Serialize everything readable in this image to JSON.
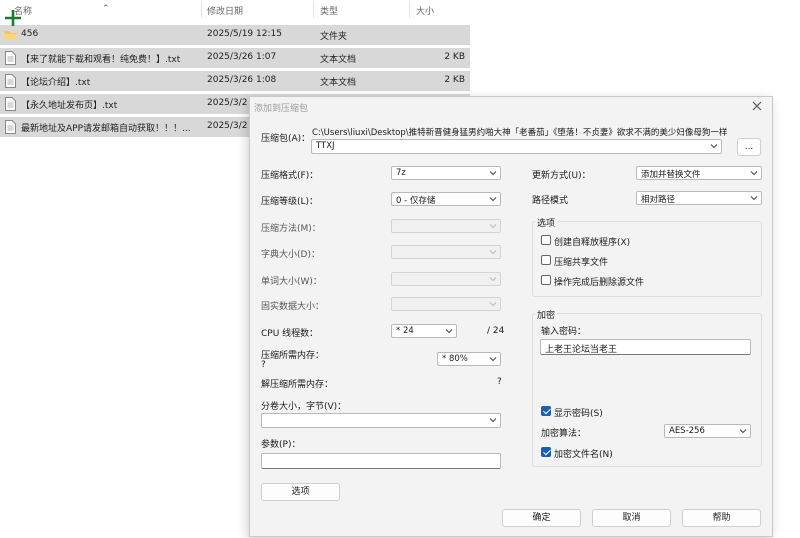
{
  "explorer": {
    "columns": {
      "name": "名称",
      "modified": "修改日期",
      "type": "类型",
      "size": "大小"
    },
    "files": [
      {
        "name": "456",
        "modified": "2025/5/19 12:15",
        "type": "文件夹",
        "size": "",
        "icon": "folder-icon"
      },
      {
        "name": "【来了就能下载和观看！纯免费！】.txt",
        "modified": "2025/3/26 1:07",
        "type": "文本文档",
        "size": "2 KB",
        "icon": "text-file-icon"
      },
      {
        "name": "【论坛介绍】.txt",
        "modified": "2025/3/26 1:08",
        "type": "文本文档",
        "size": "2 KB",
        "icon": "text-file-icon"
      },
      {
        "name": "【永久地址发布页】.txt",
        "modified": "2025/3/2",
        "type": "",
        "size": "",
        "icon": "text-file-icon"
      },
      {
        "name": "最新地址及APP请发邮箱自动获取！！！...",
        "modified": "2025/3/2",
        "type": "",
        "size": "",
        "icon": "text-file-icon"
      }
    ]
  },
  "dialog": {
    "title": "添加到压缩包",
    "archive_label": "压缩包(A)：",
    "archive_path": "C:\\Users\\liuxi\\Desktop\\推特新晋健身猛男约啪大神「老番茄」《堕落！不贞妻》欲求不满的美少妇像母狗一样",
    "archive_name": "TTXJ",
    "browse_label": "...",
    "left": {
      "format_label": "压缩格式(F)：",
      "format_value": "7z",
      "level_label": "压缩等级(L)：",
      "level_value": "0 - 仅存储",
      "method_label": "压缩方法(M)：",
      "dict_label": "字典大小(D)：",
      "word_label": "单词大小(W)：",
      "solid_label": "固实数据大小：",
      "cpu_label": "CPU 线程数：",
      "cpu_value": "* 24",
      "cpu_total": "/ 24",
      "mem_comp_label": "压缩所需内存：",
      "mem_comp_q": "?",
      "mem_comp_value": "* 80%",
      "mem_decomp_label": "解压缩所需内存：",
      "mem_decomp_q": "?",
      "split_label": "分卷大小，字节(V)：",
      "params_label": "参数(P)：",
      "options_button": "选项"
    },
    "right": {
      "update_label": "更新方式(U)：",
      "update_value": "添加并替换文件",
      "pathmode_label": "路径模式",
      "pathmode_value": "相对路径",
      "options_group": "选项",
      "opt_sfx": "创建自释放程序(X)",
      "opt_shared": "压缩共享文件",
      "opt_delete": "操作完成后删除源文件",
      "encrypt_group": "加密",
      "password_label": "输入密码：",
      "password_value": "上老王论坛当老王",
      "show_password": "显示密码(S)",
      "encrypt_method_label": "加密算法：",
      "encrypt_method_value": "AES-256",
      "encrypt_names": "加密文件名(N)"
    },
    "buttons": {
      "ok": "确定",
      "cancel": "取消",
      "help": "帮助"
    }
  }
}
